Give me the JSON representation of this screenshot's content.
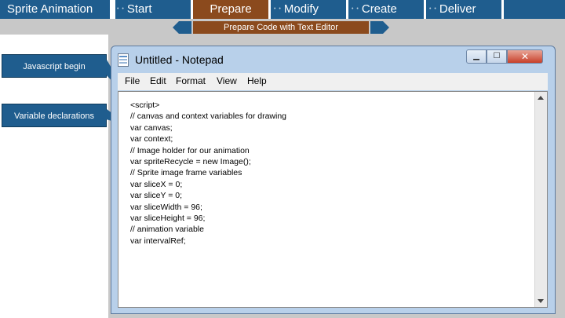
{
  "nav": {
    "title": "Sprite Animation",
    "tabs": [
      {
        "label": "Start"
      },
      {
        "label": "Prepare"
      },
      {
        "label": "Modify"
      },
      {
        "label": "Create"
      },
      {
        "label": "Deliver"
      }
    ],
    "sub_label": "Prepare Code with Text Editor"
  },
  "callouts": [
    {
      "label": "Javascript begin"
    },
    {
      "label": "Variable declarations"
    }
  ],
  "window": {
    "title": "Untitled - Notepad",
    "menu": [
      "File",
      "Edit",
      "Format",
      "View",
      "Help"
    ],
    "close_glyph": "✕"
  },
  "code_lines": [
    "<script>",
    "// canvas and context variables for drawing",
    "var canvas;",
    "var context;",
    "// Image holder for our animation",
    "var spriteRecycle = new Image();",
    "// Sprite image frame variables",
    "var sliceX = 0;",
    "var sliceY = 0;",
    "var sliceWidth = 96;",
    "var sliceHeight = 96;",
    "// animation variable",
    "var intervalRef;"
  ],
  "colors": {
    "nav_blue": "#1f5d8e",
    "active_brown": "#8b4a1d"
  }
}
